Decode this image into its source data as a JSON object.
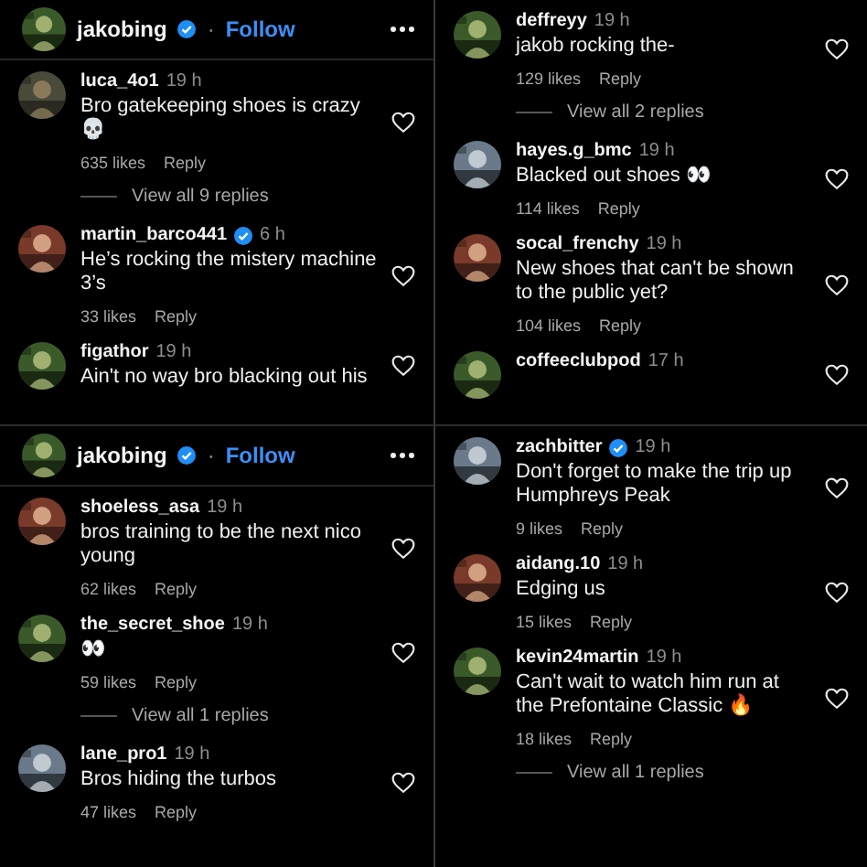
{
  "panels": [
    {
      "header": {
        "username": "jakobing",
        "verified": true,
        "separator": "·",
        "follow": "Follow"
      },
      "items": [
        {
          "kind": "comment",
          "username": "luca_4o1",
          "verified": false,
          "time": "19 h",
          "text": "Bro gatekeeping shoes is crazy💀",
          "likes": "635 likes",
          "reply": "Reply"
        },
        {
          "kind": "replies",
          "label": "View all 9 replies"
        },
        {
          "kind": "comment",
          "username": "martin_barco441",
          "verified": true,
          "time": "6 h",
          "text": "He’s rocking the mistery machine 3’s",
          "likes": "33 likes",
          "reply": "Reply"
        },
        {
          "kind": "comment",
          "username": "figathor",
          "verified": false,
          "time": "19 h",
          "text": "Ain't no way bro blacking out his"
        }
      ]
    },
    {
      "items": [
        {
          "kind": "comment",
          "username": "deffreyy",
          "verified": false,
          "time": "19 h",
          "text": "jakob rocking the-",
          "likes": "129 likes",
          "reply": "Reply"
        },
        {
          "kind": "replies",
          "label": "View all 2 replies"
        },
        {
          "kind": "comment",
          "username": "hayes.g_bmc",
          "verified": false,
          "time": "19 h",
          "text": "Blacked out shoes 👀",
          "likes": "114 likes",
          "reply": "Reply"
        },
        {
          "kind": "comment",
          "username": "socal_frenchy",
          "verified": false,
          "time": "19 h",
          "text": "New shoes that can't be shown to the public yet?",
          "likes": "104 likes",
          "reply": "Reply"
        },
        {
          "kind": "comment",
          "username": "coffeeclubpod",
          "verified": false,
          "time": "17 h"
        }
      ]
    },
    {
      "header": {
        "username": "jakobing",
        "verified": true,
        "separator": "·",
        "follow": "Follow"
      },
      "items": [
        {
          "kind": "comment",
          "username": "shoeless_asa",
          "verified": false,
          "time": "19 h",
          "text": "bros training to be the next nico young",
          "likes": "62 likes",
          "reply": "Reply"
        },
        {
          "kind": "comment",
          "username": "the_secret_shoe",
          "verified": false,
          "time": "19 h",
          "text": "👀",
          "likes": "59 likes",
          "reply": "Reply"
        },
        {
          "kind": "replies",
          "label": "View all 1 replies"
        },
        {
          "kind": "comment",
          "username": "lane_pro1",
          "verified": false,
          "time": "19 h",
          "text": "Bros hiding the turbos",
          "likes": "47 likes",
          "reply": "Reply"
        }
      ]
    },
    {
      "items": [
        {
          "kind": "comment",
          "username": "zachbitter",
          "verified": true,
          "time": "19 h",
          "text": "Don't forget to make the trip up Humphreys Peak",
          "likes": "9 likes",
          "reply": "Reply"
        },
        {
          "kind": "comment",
          "username": "aidang.10",
          "verified": false,
          "time": "19 h",
          "text": "Edging us",
          "likes": "15 likes",
          "reply": "Reply"
        },
        {
          "kind": "comment",
          "username": "kevin24martin",
          "verified": false,
          "time": "19 h",
          "text": "Can't wait to watch him run at the Prefontaine Classic 🔥",
          "likes": "18 likes",
          "reply": "Reply"
        },
        {
          "kind": "replies",
          "label": "View all 1 replies"
        }
      ]
    }
  ]
}
